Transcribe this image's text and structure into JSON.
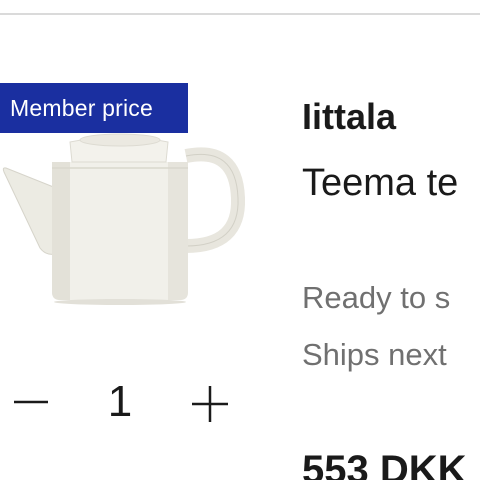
{
  "badge": {
    "label": "Member price"
  },
  "product": {
    "image_icon": "teapot-image",
    "brand": "Iittala",
    "name": "Teema te",
    "availability": "Ready to s",
    "shipping": "Ships next",
    "price": "553 DKK"
  },
  "quantity": {
    "value": "1",
    "minus_icon": "minus-icon",
    "plus_icon": "plus-icon"
  },
  "colors": {
    "badge_bg": "#1a2fa0",
    "badge_text": "#ffffff",
    "primary_text": "#1a1a1a",
    "secondary_text": "#707070",
    "divider": "#dadada"
  }
}
